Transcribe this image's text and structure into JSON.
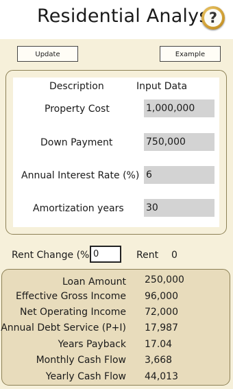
{
  "app": {
    "title": "Residential Analysis",
    "help_glyph": "?"
  },
  "toolbar": {
    "update_label": "Update",
    "example_label": "Example"
  },
  "inputs": {
    "header_description": "Description",
    "header_input": "Input Data",
    "rows": [
      {
        "label": "Property Cost",
        "value": "1,000,000"
      },
      {
        "label": "Down Payment",
        "value": "750,000"
      },
      {
        "label": "Annual Interest Rate (%)",
        "value": "6"
      },
      {
        "label": "Amortization years",
        "value": "30"
      }
    ]
  },
  "rent": {
    "change_label": "Rent Change (%)",
    "change_value": "0",
    "rent_label": "Rent",
    "rent_value": "0"
  },
  "results": [
    {
      "label": "Loan Amount",
      "value": "250,000"
    },
    {
      "label": "Effective Gross Income",
      "value": "96,000"
    },
    {
      "label": "Net Operating Income",
      "value": "72,000"
    },
    {
      "label": "Annual Debt Service (P+I)",
      "value": "17,987"
    },
    {
      "label": "Years Payback",
      "value": "17.04"
    },
    {
      "label": "Monthly Cash Flow",
      "value": "3,668"
    },
    {
      "label": "Yearly Cash Flow",
      "value": "44,013"
    }
  ],
  "colors": {
    "background": "#f6f0da",
    "results_panel": "#e8dcbc",
    "field": "#d3d3d3",
    "help_ring": "#c9962a"
  },
  "icons": {
    "help": "help-question-icon"
  }
}
